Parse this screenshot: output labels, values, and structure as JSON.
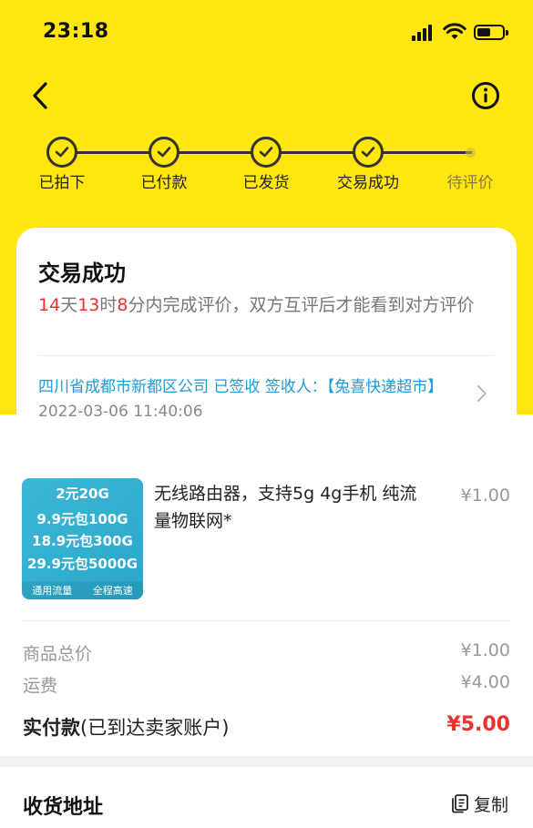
{
  "status_bar": {
    "time": "23:18"
  },
  "steps": [
    {
      "label": "已拍下",
      "done": true
    },
    {
      "label": "已付款",
      "done": true
    },
    {
      "label": "已发货",
      "done": true
    },
    {
      "label": "交易成功",
      "done": true
    },
    {
      "label": "待评价",
      "done": false
    }
  ],
  "status_card": {
    "title": "交易成功",
    "countdown": {
      "days": "14",
      "days_unit": "天",
      "hours": "13",
      "hours_unit": "时",
      "minutes": "8",
      "minutes_unit": "分内完成评价，双方互评后才能看到对方评价"
    },
    "logistics": "四川省成都市新都区公司 已签收 签收人：【兔喜快递超市】",
    "logistics_time": "2022-03-06 11:40:06"
  },
  "product": {
    "image_lines": [
      "2元20G",
      "9.9元包100G",
      "18.9元包300G",
      "29.9元包5000G"
    ],
    "image_footer": [
      "通用流量",
      "全程高速"
    ],
    "title": "无线路由器，支持5g 4g手机 纯流量物联网*",
    "price": "¥1.00"
  },
  "summary": {
    "goods_total_label": "商品总价",
    "goods_total_value": "¥1.00",
    "shipping_label": "运费",
    "shipping_value": "¥4.00",
    "paid_label": "实付款",
    "paid_note": "(已到达卖家账户)",
    "paid_value": "¥5.00"
  },
  "address": {
    "title": "收货地址",
    "copy_label": "复制"
  },
  "colors": {
    "brand_yellow": "#FFE60F",
    "accent_red": "#E8322E",
    "link_blue": "#1E9BD7"
  }
}
